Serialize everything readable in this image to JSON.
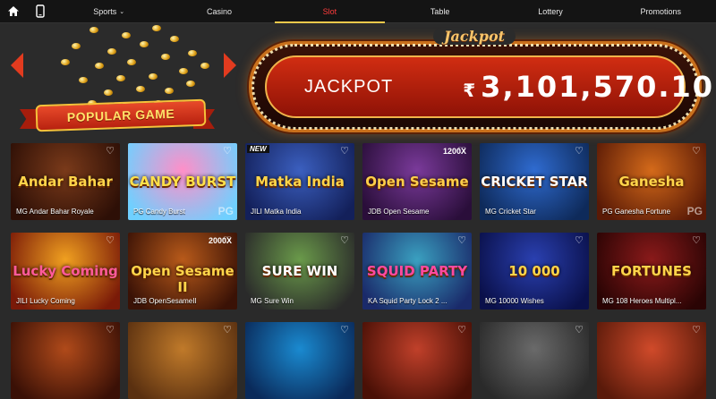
{
  "nav": {
    "items": [
      {
        "label": "Sports",
        "has_caret": true
      },
      {
        "label": "Casino"
      },
      {
        "label": "Slot",
        "active": true
      },
      {
        "label": "Table"
      },
      {
        "label": "Lottery"
      },
      {
        "label": "Promotions"
      }
    ],
    "caret_glyph": "⌄"
  },
  "hero": {
    "banner_label": "POPULAR GAME",
    "jackpot_script": "Jackpot",
    "jackpot_label": "JACKPOT",
    "jackpot_currency": "₹",
    "jackpot_value": "3,101,570.10"
  },
  "colors": {
    "accent": "#f0c84b",
    "active": "#ff3b3b",
    "nav_bg": "#141414",
    "page_bg": "#2a2a2a"
  },
  "games": [
    {
      "title": "MG Andar Bahar Royale",
      "logo": "Andar Bahar",
      "bg1": "#7a3a1a",
      "bg2": "#2d0f06",
      "logo_color": "#ffd54a"
    },
    {
      "title": "PG Candy Burst",
      "logo": "CANDY BURST",
      "bg1": "#ff8fc8",
      "bg2": "#6fd0ff",
      "logo_color": "#ffe14a",
      "badge_pg": "PG"
    },
    {
      "title": "JILI Matka India",
      "logo": "Matka India",
      "bg1": "#3b5fbf",
      "bg2": "#13205a",
      "logo_color": "#ffd54a",
      "tag": "NEW"
    },
    {
      "title": "JDB Open Sesame",
      "logo": "Open Sesame",
      "bg1": "#7a3a9a",
      "bg2": "#2a0e3a",
      "logo_color": "#ffcf4a",
      "mult": "1200X"
    },
    {
      "title": "MG Cricket Star",
      "logo": "CRICKET STAR",
      "bg1": "#2f6bd0",
      "bg2": "#0e2a5a",
      "logo_color": "#ffffff"
    },
    {
      "title": "PG Ganesha Fortune",
      "logo": "Ganesha",
      "bg1": "#d46a1a",
      "bg2": "#5a1a06",
      "logo_color": "#ffd54a",
      "badge_pg": "PG"
    },
    {
      "title": "JILI Lucky Coming",
      "logo": "Lucky Coming",
      "bg1": "#f0a020",
      "bg2": "#7a1a08",
      "logo_color": "#ff5a9a"
    },
    {
      "title": "JDB OpenSesameII",
      "logo": "Open Sesame II",
      "bg1": "#b85a1a",
      "bg2": "#3a1206",
      "logo_color": "#ffd54a",
      "mult": "2000X"
    },
    {
      "title": "MG Sure Win",
      "logo": "SURE WIN",
      "bg1": "#6a9a4a",
      "bg2": "#2a2a2a",
      "logo_color": "#ffffff"
    },
    {
      "title": "KA Squid Party Lock 2 ...",
      "logo": "SQUID PARTY",
      "bg1": "#3aa0c0",
      "bg2": "#1a2a6a",
      "logo_color": "#ff4aa0"
    },
    {
      "title": "MG 10000 Wishes",
      "logo": "10 000",
      "bg1": "#2a40b0",
      "bg2": "#0a104a",
      "logo_color": "#ffd54a"
    },
    {
      "title": "MG 108 Heroes Multipl...",
      "logo": "FORTUNES",
      "bg1": "#8a1a1a",
      "bg2": "#2a0404",
      "logo_color": "#ffd54a"
    },
    {
      "title": "",
      "logo": "",
      "bg1": "#b04a1a",
      "bg2": "#3a1006",
      "logo_color": "#ffd54a"
    },
    {
      "title": "",
      "logo": "",
      "bg1": "#c07a2a",
      "bg2": "#5a3010",
      "logo_color": "#ffd54a"
    },
    {
      "title": "",
      "logo": "",
      "bg1": "#1a8ad0",
      "bg2": "#0a2a5a",
      "logo_color": "#ffd54a"
    },
    {
      "title": "",
      "logo": "",
      "bg1": "#c0402a",
      "bg2": "#4a1006",
      "logo_color": "#ffd54a"
    },
    {
      "title": "",
      "logo": "",
      "bg1": "#6a6a6a",
      "bg2": "#2a2a2a",
      "logo_color": "#ffd54a"
    },
    {
      "title": "",
      "logo": "",
      "bg1": "#d04a2a",
      "bg2": "#5a1a0a",
      "logo_color": "#ffd54a"
    }
  ]
}
